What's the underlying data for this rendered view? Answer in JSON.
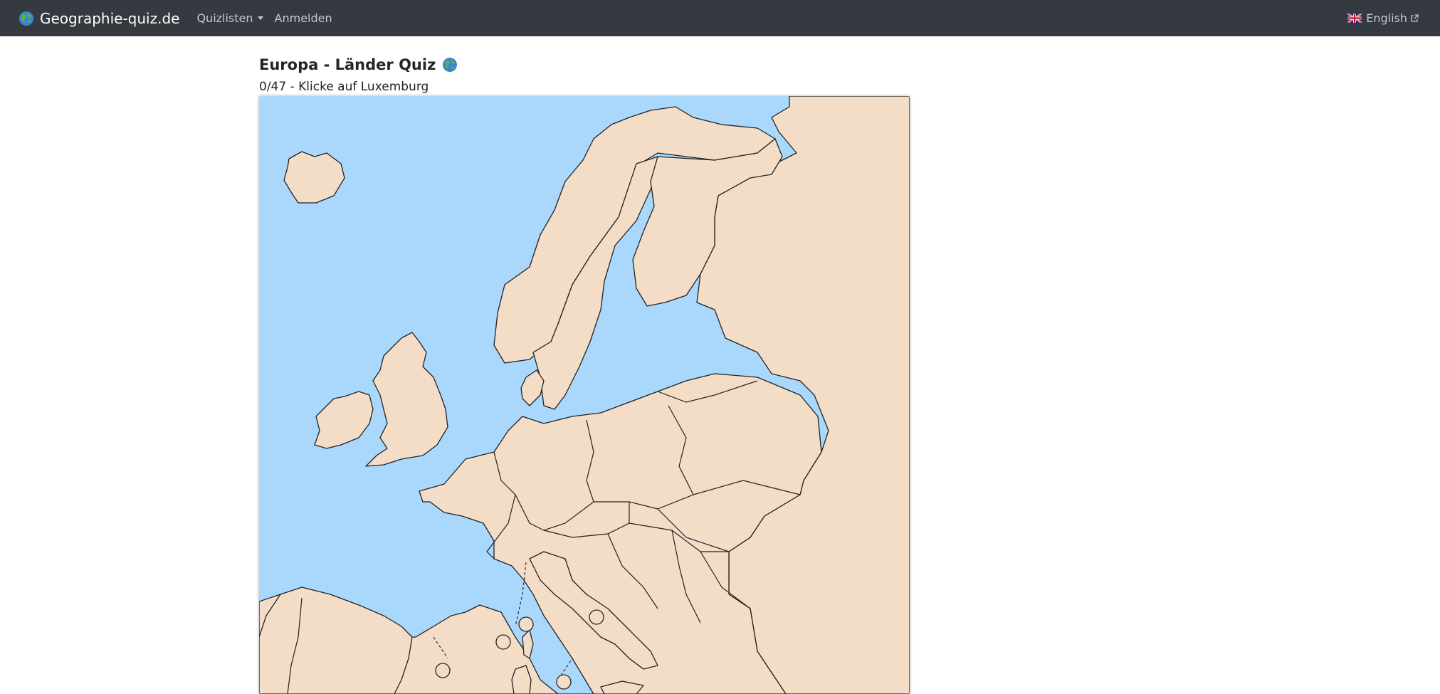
{
  "navbar": {
    "brand": "Geographie-quiz.de",
    "brand_icon": "globe-icon",
    "quizlists": "Quizlisten",
    "login": "Anmelden",
    "language": "English",
    "language_icon": "uk-flag-icon",
    "background": "#343a40"
  },
  "quiz": {
    "title": "Europa - Länder Quiz",
    "progress": "0/47",
    "separator": " - ",
    "instruction": "Klicke auf Luxemburg",
    "answered": 0,
    "total": 47
  },
  "colors": {
    "water": "#aad8fd",
    "land": "#f3ddc6",
    "border": "#222222"
  }
}
